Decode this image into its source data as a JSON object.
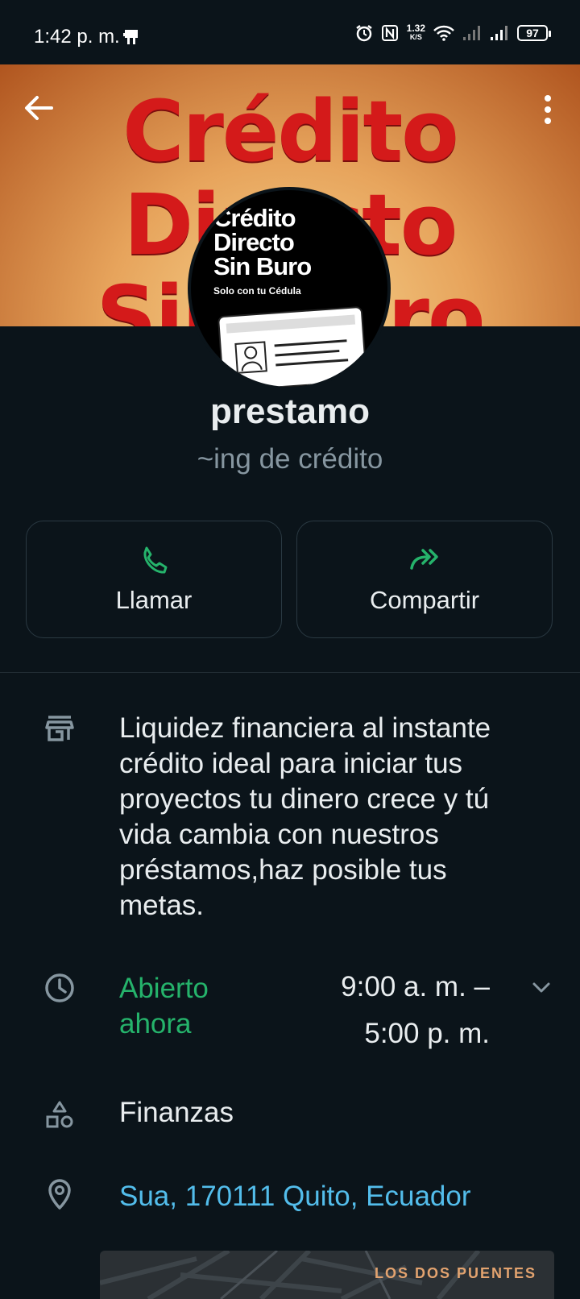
{
  "status_bar": {
    "time": "1:42 p. m.",
    "speed_value": "1.32",
    "speed_unit": "K/S",
    "battery": "97"
  },
  "cover": {
    "line1": "Crédito",
    "line2": "Directo",
    "line3": "Sin Buro"
  },
  "avatar": {
    "line1": "Crédito",
    "line2": "Directo",
    "line3": "Sin Buro",
    "sub": "Solo con tu Cédula"
  },
  "profile": {
    "name": "prestamo",
    "subtitle": "~ing de crédito"
  },
  "actions": {
    "call_label": "Llamar",
    "share_label": "Compartir"
  },
  "business": {
    "description": "Liquidez financiera al instante crédito ideal para iniciar tus proyectos tu dinero crece y tú vida cambia con nuestros préstamos,haz posible tus metas.",
    "open_status": "Abierto ahora",
    "hours_open": "9:00 a. m. –",
    "hours_close": "5:00 p. m.",
    "category": "Finanzas",
    "address": "Sua, 170111 Quito, Ecuador"
  },
  "map": {
    "label": "LOS DOS PUENTES"
  },
  "colors": {
    "background": "#0b141a",
    "accent_green": "#25b36b",
    "link_blue": "#53bdeb",
    "muted_text": "#8696a0"
  }
}
